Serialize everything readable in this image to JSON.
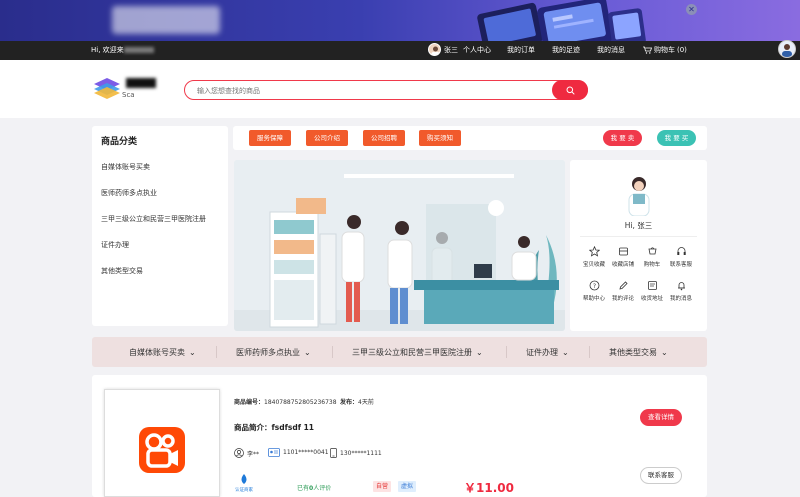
{
  "colors": {
    "accent": "#ef2a40",
    "orange": "#f15a2b",
    "teal": "#3bc2b4",
    "dark": "#222222"
  },
  "banner": {
    "close_glyph": "✕"
  },
  "topnav": {
    "welcome": "Hi, 欢迎来",
    "user_name": "张三",
    "links": [
      "个人中心",
      "我的订单",
      "我的足迹",
      "我的消息"
    ],
    "cart_label": "购物车",
    "cart_count": "(0)"
  },
  "header": {
    "logo_sub": "Sca",
    "search_placeholder": "输入您想查找的商品"
  },
  "categories": {
    "title": "商品分类",
    "items": [
      "自媒体账号买卖",
      "医师药师多点执业",
      "三甲三级公立和民营三甲医院注册",
      "证件办理",
      "其他类型交易"
    ]
  },
  "actionbar": {
    "tags": [
      "服务保障",
      "公司介绍",
      "公司招聘",
      "购买须知"
    ],
    "sell_label": "我 要 卖",
    "buy_label": "我 要 买"
  },
  "usercard": {
    "greeting": "Hi, 张三",
    "quick": [
      {
        "label": "宝贝收藏",
        "icon": "star-icon"
      },
      {
        "label": "收藏店铺",
        "icon": "store-icon"
      },
      {
        "label": "购物车",
        "icon": "cart-icon"
      },
      {
        "label": "联系客服",
        "icon": "headset-icon"
      },
      {
        "label": "帮助中心",
        "icon": "help-icon"
      },
      {
        "label": "我的评论",
        "icon": "edit-icon"
      },
      {
        "label": "收货地址",
        "icon": "address-icon"
      },
      {
        "label": "我的消息",
        "icon": "bell-icon"
      }
    ]
  },
  "strip": {
    "items": [
      "自媒体账号买卖",
      "医师药师多点执业",
      "三甲三级公立和民营三甲医院注册",
      "证件办理",
      "其他类型交易"
    ]
  },
  "product": {
    "code_label": "商品编号：",
    "code_value": "1840788752805236738",
    "publish_label": "发布：",
    "publish_value": "4天前",
    "intro_label": "商品简介：",
    "intro_value": "fsdfsdf 11",
    "seller": "李**",
    "id_card": "1101*****0041",
    "phone": "130*****1111",
    "certified": "认证商家",
    "review_prefix": "已有",
    "review_count": "0",
    "review_suffix": "人评价",
    "badge_self": "自营",
    "badge_virtual": "虚拟",
    "price": "￥11.00",
    "detail_btn": "查看详情",
    "contact_btn": "联系客服"
  }
}
